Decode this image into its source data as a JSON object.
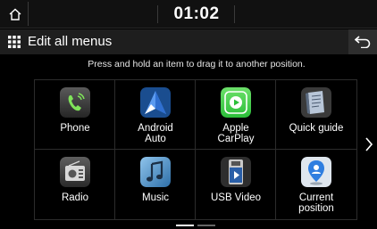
{
  "status": {
    "time": "01:02"
  },
  "header": {
    "title": "Edit all menus"
  },
  "instruction": "Press and hold an item to drag it to another position.",
  "menu_items": [
    {
      "label": "Phone",
      "icon": "phone-icon"
    },
    {
      "label": "Android\nAuto",
      "icon": "android-auto-icon"
    },
    {
      "label": "Apple\nCarPlay",
      "icon": "apple-carplay-icon"
    },
    {
      "label": "Quick guide",
      "icon": "quick-guide-icon"
    },
    {
      "label": "Radio",
      "icon": "radio-icon"
    },
    {
      "label": "Music",
      "icon": "music-icon"
    },
    {
      "label": "USB Video",
      "icon": "usb-video-icon"
    },
    {
      "label": "Current\nposition",
      "icon": "current-position-icon"
    }
  ],
  "pagination": {
    "current_page": 1,
    "total_pages": 2
  },
  "colors": {
    "background": "#000000",
    "header_bar": "#1e1e1e",
    "carplay_green": "#3ecf4e",
    "position_blue": "#2f7ee0"
  }
}
